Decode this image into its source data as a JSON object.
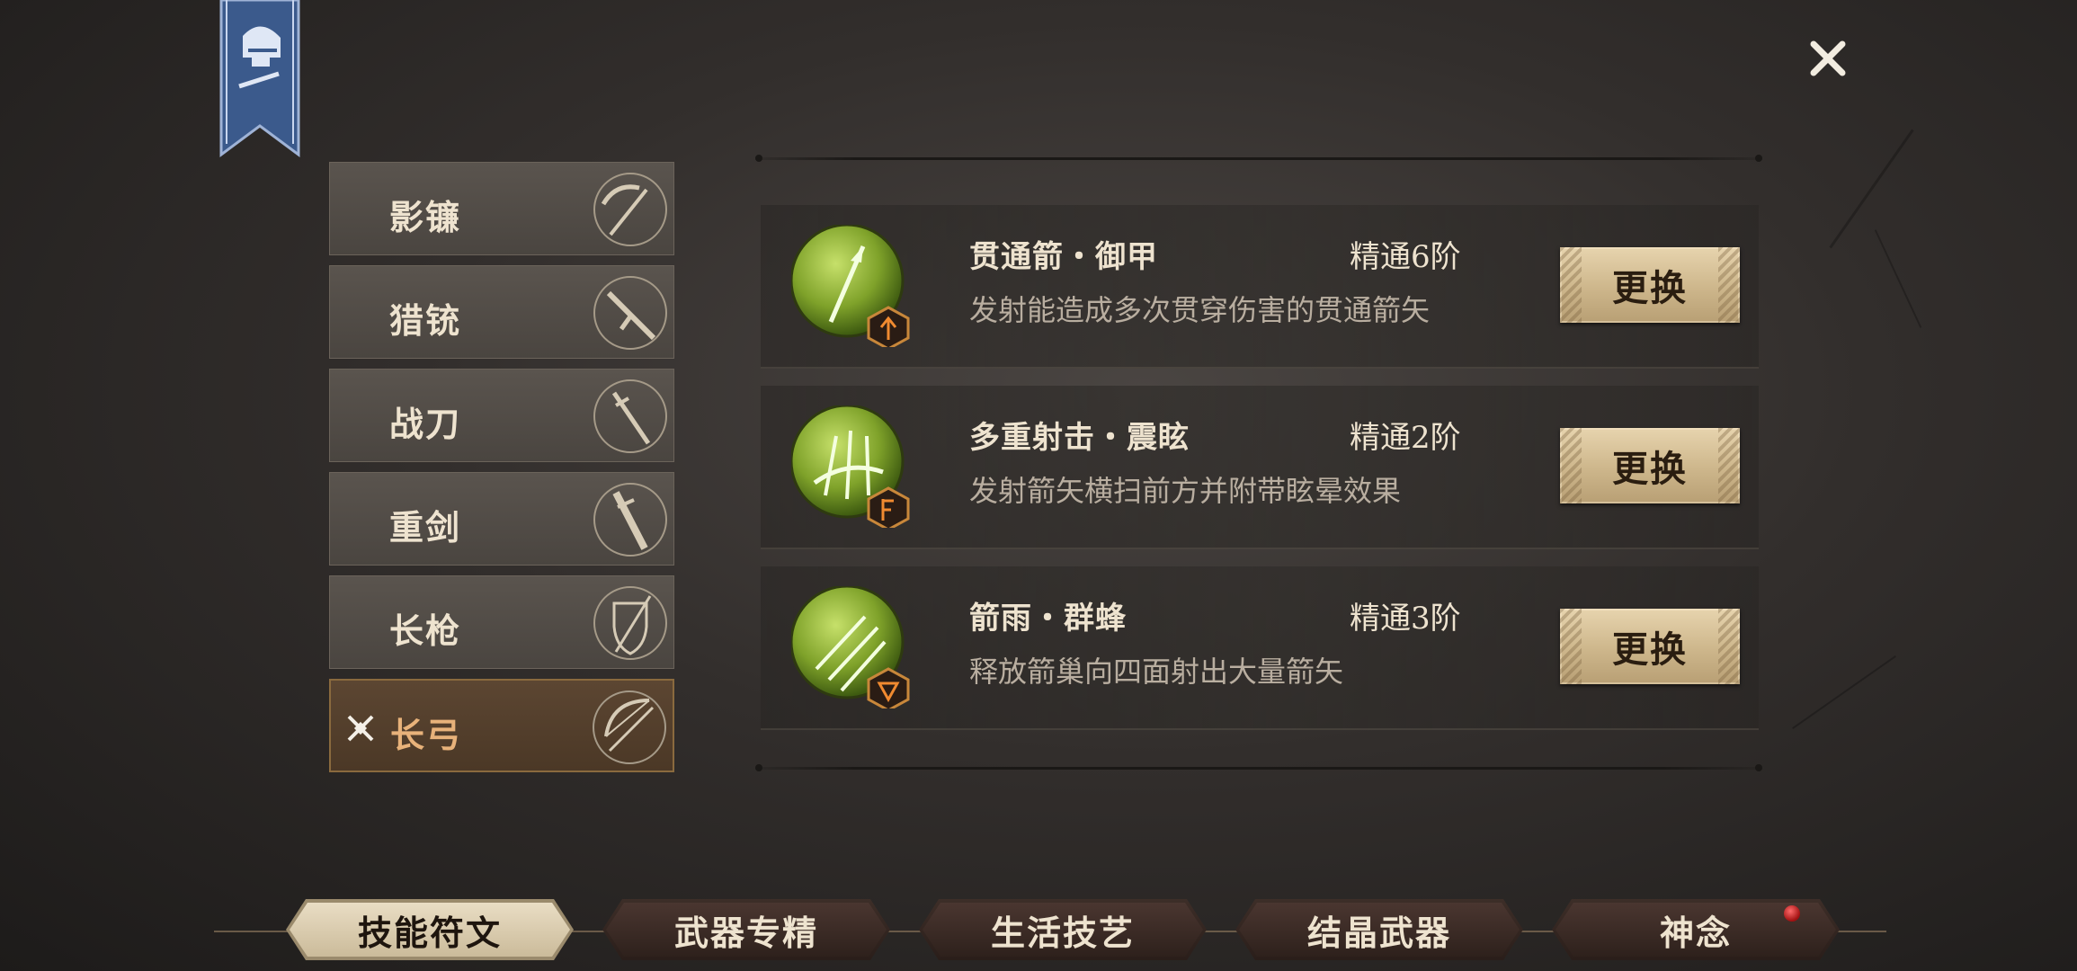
{
  "close": {
    "icon": "close-icon"
  },
  "banner": {
    "icon": "knight-helmet-icon",
    "color": "#3b5a8c"
  },
  "weapons": [
    {
      "label": "影镰",
      "icon": "scythe-icon"
    },
    {
      "label": "猎铳",
      "icon": "musket-icon"
    },
    {
      "label": "战刀",
      "icon": "sword-icon"
    },
    {
      "label": "重剑",
      "icon": "greatsword-icon"
    },
    {
      "label": "长枪",
      "icon": "spear-shield-icon"
    },
    {
      "label": "长弓",
      "icon": "bow-icon",
      "active": true
    }
  ],
  "skills": [
    {
      "name": "贯通箭・御甲",
      "rank": "精通6阶",
      "desc": "发射能造成多次贯穿伤害的贯通箭矢",
      "button": "更换",
      "icon": "piercing-arrow-icon",
      "rune_icon": "rune-arrow-up-icon"
    },
    {
      "name": "多重射击・震眩",
      "rank": "精通2阶",
      "desc": "发射箭矢横扫前方并附带眩晕效果",
      "button": "更换",
      "icon": "multi-arrow-icon",
      "rune_icon": "rune-f-icon"
    },
    {
      "name": "箭雨・群蜂",
      "rank": "精通3阶",
      "desc": "释放箭巢向四面射出大量箭矢",
      "button": "更换",
      "icon": "arrow-rain-icon",
      "rune_icon": "rune-triangle-icon"
    }
  ],
  "bottom_tabs": [
    {
      "label": "技能符文",
      "active": true
    },
    {
      "label": "武器专精"
    },
    {
      "label": "生活技艺"
    },
    {
      "label": "结晶武器"
    },
    {
      "label": "神念",
      "badge": true
    }
  ],
  "colors": {
    "accent": "#e8b27a",
    "orb": "#7fa22a",
    "button": "#d9c49b"
  }
}
